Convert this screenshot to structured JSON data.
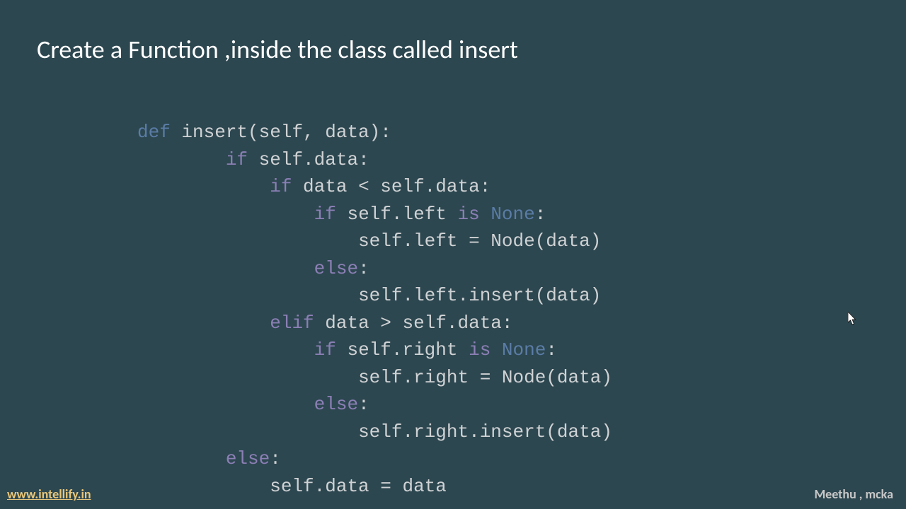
{
  "title": "Create a Function ,inside the class called insert",
  "code": {
    "kw_def": "def",
    "func_name": " insert(self, data):",
    "line2_indent": "        ",
    "kw_if1": "if",
    "line2_rest": " self.data:",
    "line3_indent": "            ",
    "kw_if2": "if",
    "line3_rest": " data < self.data:",
    "line4_indent": "                ",
    "kw_if3": "if",
    "line4_mid": " self.left ",
    "kw_is1": "is",
    "line4_sp": " ",
    "kw_none1": "None",
    "line4_end": ":",
    "line5_indent": "                    ",
    "line5_rest": "self.left = Node(data)",
    "line6_indent": "                ",
    "kw_else1": "else",
    "line6_end": ":",
    "line7_indent": "                    ",
    "line7_rest": "self.left.insert(data)",
    "line8_indent": "            ",
    "kw_elif": "elif",
    "line8_rest": " data > self.data:",
    "line9_indent": "                ",
    "kw_if4": "if",
    "line9_mid": " self.right ",
    "kw_is2": "is",
    "line9_sp": " ",
    "kw_none2": "None",
    "line9_end": ":",
    "line10_indent": "                    ",
    "line10_rest": "self.right = Node(data)",
    "line11_indent": "                ",
    "kw_else2": "else",
    "line11_end": ":",
    "line12_indent": "                    ",
    "line12_rest": "self.right.insert(data)",
    "line13_indent": "        ",
    "kw_else3": "else",
    "line13_end": ":",
    "line14_indent": "            ",
    "line14_rest": "self.data = data"
  },
  "footer": {
    "link": "www.intellify.in",
    "author": "Meethu , mcka"
  }
}
